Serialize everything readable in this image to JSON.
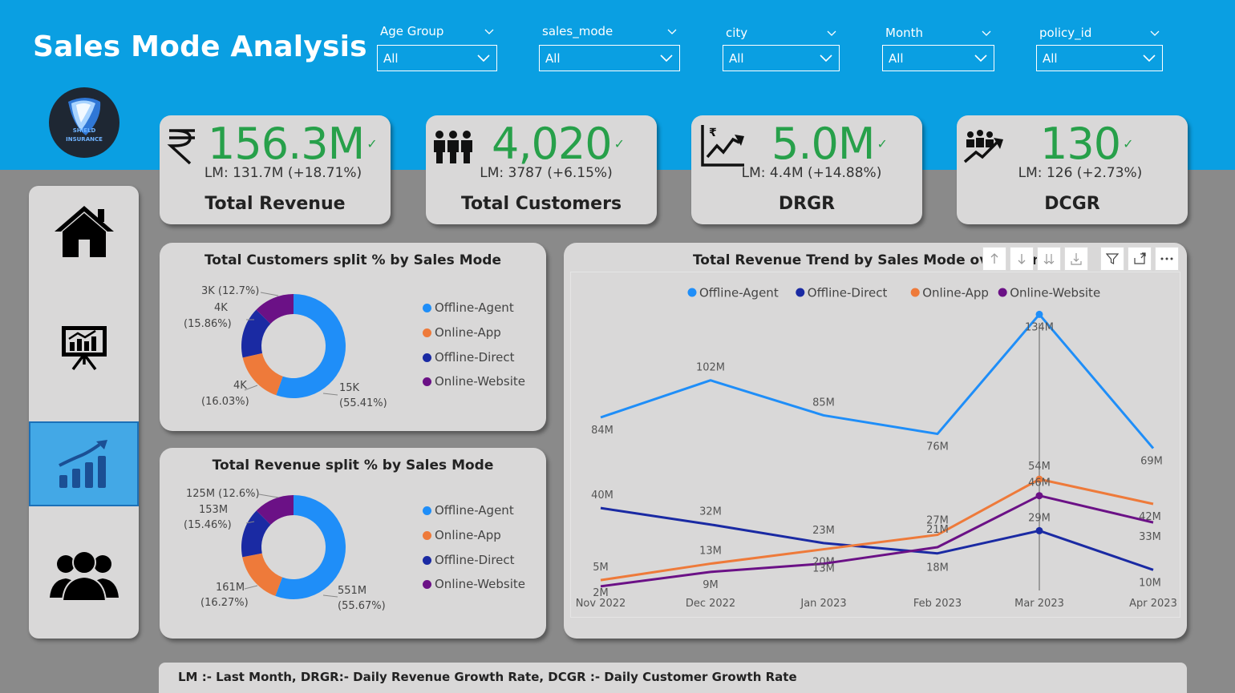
{
  "header": {
    "title": "Sales Mode Analysis",
    "logo_text_line1": "SHIELD",
    "logo_text_line2": "INSURANCE"
  },
  "slicers": [
    {
      "label": "Age Group",
      "value": "All"
    },
    {
      "label": "sales_mode",
      "value": "All"
    },
    {
      "label": "city",
      "value": "All"
    },
    {
      "label": "Month",
      "value": "All"
    },
    {
      "label": "policy_id",
      "value": "All"
    }
  ],
  "nav": {
    "items": [
      "home-icon",
      "presentation-chart-icon",
      "growth-chart-icon",
      "users-group-icon"
    ],
    "active_index": 2
  },
  "kpis": [
    {
      "value": "156.3M",
      "lm": "LM: 131.7M (+18.71%)",
      "name": "Total Revenue",
      "icon": "rupee-icon"
    },
    {
      "value": "4,020",
      "lm": "LM: 3787 (+6.15%)",
      "name": "Total Customers",
      "icon": "customers-icon"
    },
    {
      "value": "5.0M",
      "lm": "LM: 4.4M (+14.88%)",
      "name": "DRGR",
      "icon": "revenue-growth-icon"
    },
    {
      "value": "130",
      "lm": "LM: 126 (+2.73%)",
      "name": "DCGR",
      "icon": "customer-growth-icon"
    }
  ],
  "colors": {
    "offline_agent": "#1f8ef8",
    "online_app": "#ee7a3a",
    "offline_direct": "#1a2aa3",
    "online_website": "#6b1186",
    "kpi_value": "#27a04a",
    "header_bg": "#0a9fe2"
  },
  "chart_data": [
    {
      "type": "pie",
      "title": "Total Customers split % by Sales Mode",
      "categories": [
        "Offline-Agent",
        "Online-App",
        "Offline-Direct",
        "Online-Website"
      ],
      "legend": [
        "Offline-Agent",
        "Online-App",
        "Offline-Direct",
        "Online-Website"
      ],
      "values": [
        55.41,
        16.03,
        15.86,
        12.7
      ],
      "labels": {
        "offline_agent": [
          "15K",
          "(55.41%)"
        ],
        "online_app": [
          "4K",
          "(16.03%)"
        ],
        "offline_direct": [
          "4K",
          "(15.86%)"
        ],
        "online_website": [
          "3K (12.7%)"
        ]
      }
    },
    {
      "type": "pie",
      "title": "Total Revenue split % by Sales Mode",
      "categories": [
        "Offline-Agent",
        "Online-App",
        "Offline-Direct",
        "Online-Website"
      ],
      "legend": [
        "Offline-Agent",
        "Online-App",
        "Offline-Direct",
        "Online-Website"
      ],
      "values": [
        55.67,
        16.27,
        15.46,
        12.6
      ],
      "labels": {
        "offline_agent": [
          "551M",
          "(55.67%)"
        ],
        "online_app": [
          "161M",
          "(16.27%)"
        ],
        "offline_direct": [
          "153M",
          "(15.46%)"
        ],
        "online_website": [
          "125M (12.6%)"
        ]
      }
    },
    {
      "type": "line",
      "title": "Total Revenue Trend by Sales Mode over Month",
      "x": [
        "Nov 2022",
        "Dec 2022",
        "Jan 2023",
        "Feb 2023",
        "Mar 2023",
        "Apr 2023"
      ],
      "ylim": [
        0,
        140
      ],
      "series": [
        {
          "name": "Offline-Agent",
          "values": [
            84,
            102,
            85,
            76,
            134,
            69
          ],
          "labels": [
            "84M",
            "102M",
            "85M",
            "76M",
            "134M",
            "69M"
          ]
        },
        {
          "name": "Offline-Direct",
          "values": [
            40,
            32,
            23,
            18,
            29,
            10
          ],
          "labels": [
            "40M",
            "32M",
            "23M",
            "18M",
            "29M",
            "10M"
          ]
        },
        {
          "name": "Online-App",
          "values": [
            5,
            13,
            20,
            27,
            54,
            42
          ],
          "labels": [
            "5M",
            "13M",
            "20M",
            "27M",
            "54M",
            "42M"
          ]
        },
        {
          "name": "Online-Website",
          "values": [
            2,
            9,
            13,
            21,
            46,
            33
          ],
          "labels": [
            "2M",
            "9M",
            "13M",
            "21M",
            "46M",
            "33M"
          ]
        }
      ]
    }
  ],
  "footer": {
    "text": "LM :- Last Month, DRGR:- Daily Revenue Growth Rate, DCGR :- Daily Customer Growth Rate"
  }
}
